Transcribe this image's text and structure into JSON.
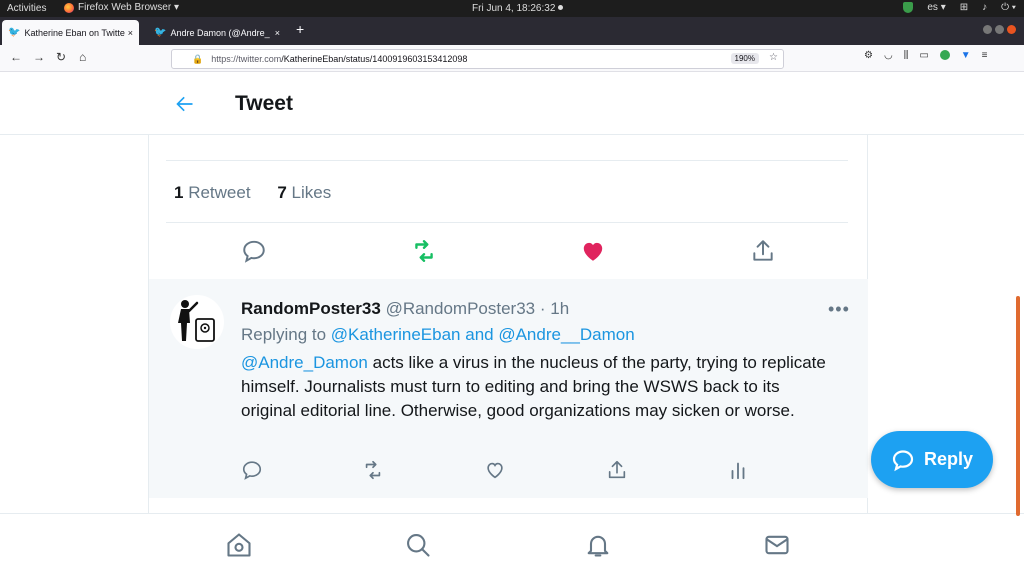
{
  "os_topbar": {
    "activities": "Activities",
    "app_menu": "Firefox Web Browser ▾",
    "clock": "Fri Jun  4, 18:26:32",
    "lang": "es ▾"
  },
  "browser": {
    "tabs": [
      {
        "label": "Katherine Eban on Twitte",
        "active": true
      },
      {
        "label": "Andre Damon (@Andre_",
        "active": false
      }
    ],
    "url_host": "https://twitter.com",
    "url_path": "/KatherineEban/status/1400919603153412098",
    "zoom": "190%"
  },
  "header": {
    "title": "Tweet"
  },
  "stats": {
    "retweets_count": "1",
    "retweets_label": "Retweet",
    "likes_count": "7",
    "likes_label": "Likes"
  },
  "colors": {
    "accent": "#1da1f2",
    "retweet_green": "#17bf63",
    "like_red": "#e0245e"
  },
  "reply": {
    "name": "RandomPoster33",
    "handle": "@RandomPoster33",
    "sep": " · ",
    "time": "1h",
    "replying_prefix": "Replying to ",
    "replying_to": "@KatherineEban and @Andre__Damon",
    "mention": "@Andre_Damon",
    "text": " acts like a virus in the nucleus of the party, trying to replicate himself.  Journalists must turn to editing and bring the WSWS back to its original editorial line. Otherwise, good organizations may sicken or worse."
  },
  "fab": {
    "label": "Reply"
  }
}
